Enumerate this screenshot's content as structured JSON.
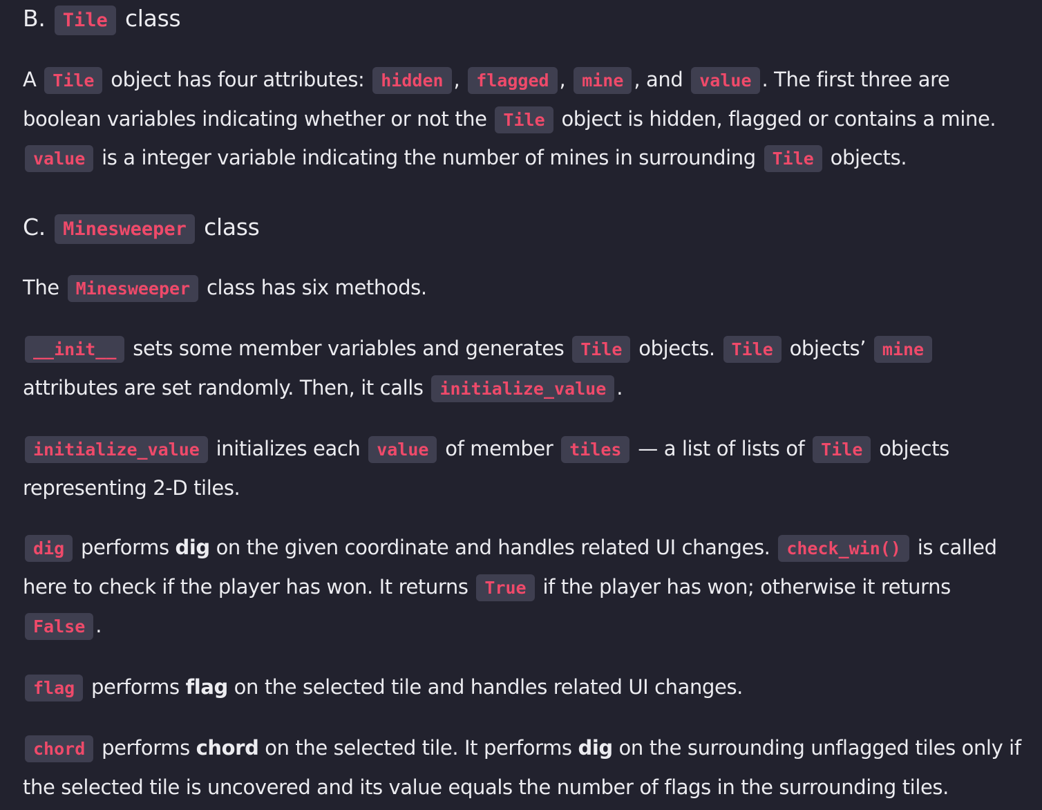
{
  "accent_code_color": "#ef4a6a",
  "blocks": [
    {
      "type": "h",
      "cls": "b",
      "name": "heading-tile-class",
      "segs": [
        {
          "t": "B. "
        },
        {
          "c": "Tile"
        },
        {
          "t": " class"
        }
      ]
    },
    {
      "type": "p",
      "cls": "first",
      "name": "tile-attributes-paragraph",
      "segs": [
        {
          "t": "A "
        },
        {
          "c": "Tile"
        },
        {
          "t": " object has four attributes: "
        },
        {
          "c": "hidden"
        },
        {
          "t": ", "
        },
        {
          "c": "flagged"
        },
        {
          "t": ", "
        },
        {
          "c": "mine"
        },
        {
          "t": ", and "
        },
        {
          "c": "value"
        },
        {
          "t": ". The first three are boolean variables indicating whether or not the "
        },
        {
          "c": "Tile"
        },
        {
          "t": " object is hidden, flagged or contains a mine. "
        },
        {
          "c": "value"
        },
        {
          "t": " is a integer variable indicating the number of mines in surrounding "
        },
        {
          "c": "Tile"
        },
        {
          "t": " objects."
        }
      ]
    },
    {
      "type": "h",
      "cls": "c",
      "name": "heading-minesweeper-class",
      "segs": [
        {
          "t": "C. "
        },
        {
          "c": "Minesweeper"
        },
        {
          "t": " class"
        }
      ]
    },
    {
      "type": "p",
      "cls": "after-c",
      "name": "minesweeper-intro-paragraph",
      "segs": [
        {
          "t": "The "
        },
        {
          "c": "Minesweeper"
        },
        {
          "t": " class has six methods."
        }
      ]
    },
    {
      "type": "p",
      "name": "init-paragraph",
      "segs": [
        {
          "c": "__init__"
        },
        {
          "t": " sets some member variables and generates "
        },
        {
          "c": "Tile"
        },
        {
          "t": " objects. "
        },
        {
          "c": "Tile"
        },
        {
          "t": " objects’ "
        },
        {
          "c": "mine"
        },
        {
          "t": " attributes are set randomly. Then, it calls "
        },
        {
          "c": "initialize_value"
        },
        {
          "t": "."
        }
      ]
    },
    {
      "type": "p",
      "name": "initialize-value-paragraph",
      "segs": [
        {
          "c": "initialize_value"
        },
        {
          "t": " initializes each "
        },
        {
          "c": "value"
        },
        {
          "t": " of member "
        },
        {
          "c": "tiles"
        },
        {
          "t": " — a list of lists of "
        },
        {
          "c": "Tile"
        },
        {
          "t": " objects representing 2-D tiles."
        }
      ]
    },
    {
      "type": "p",
      "name": "dig-paragraph",
      "segs": [
        {
          "c": "dig"
        },
        {
          "t": " performs "
        },
        {
          "b": "dig"
        },
        {
          "t": " on the given coordinate and handles related UI changes. "
        },
        {
          "c": "check_win()"
        },
        {
          "t": " is called here to check if the player has won. It returns "
        },
        {
          "c": "True"
        },
        {
          "t": " if the player has won; otherwise it returns "
        },
        {
          "c": "False"
        },
        {
          "t": "."
        }
      ]
    },
    {
      "type": "p",
      "name": "flag-paragraph",
      "segs": [
        {
          "c": "flag"
        },
        {
          "t": " performs "
        },
        {
          "b": "flag"
        },
        {
          "t": " on the selected tile and handles related UI changes."
        }
      ]
    },
    {
      "type": "p",
      "name": "chord-paragraph",
      "segs": [
        {
          "c": "chord"
        },
        {
          "t": " performs "
        },
        {
          "b": "chord"
        },
        {
          "t": " on the selected tile. It performs "
        },
        {
          "b": "dig"
        },
        {
          "t": " on the surrounding unflagged tiles only if the selected tile is uncovered and its value equals the number of flags in the surrounding tiles."
        }
      ]
    }
  ]
}
